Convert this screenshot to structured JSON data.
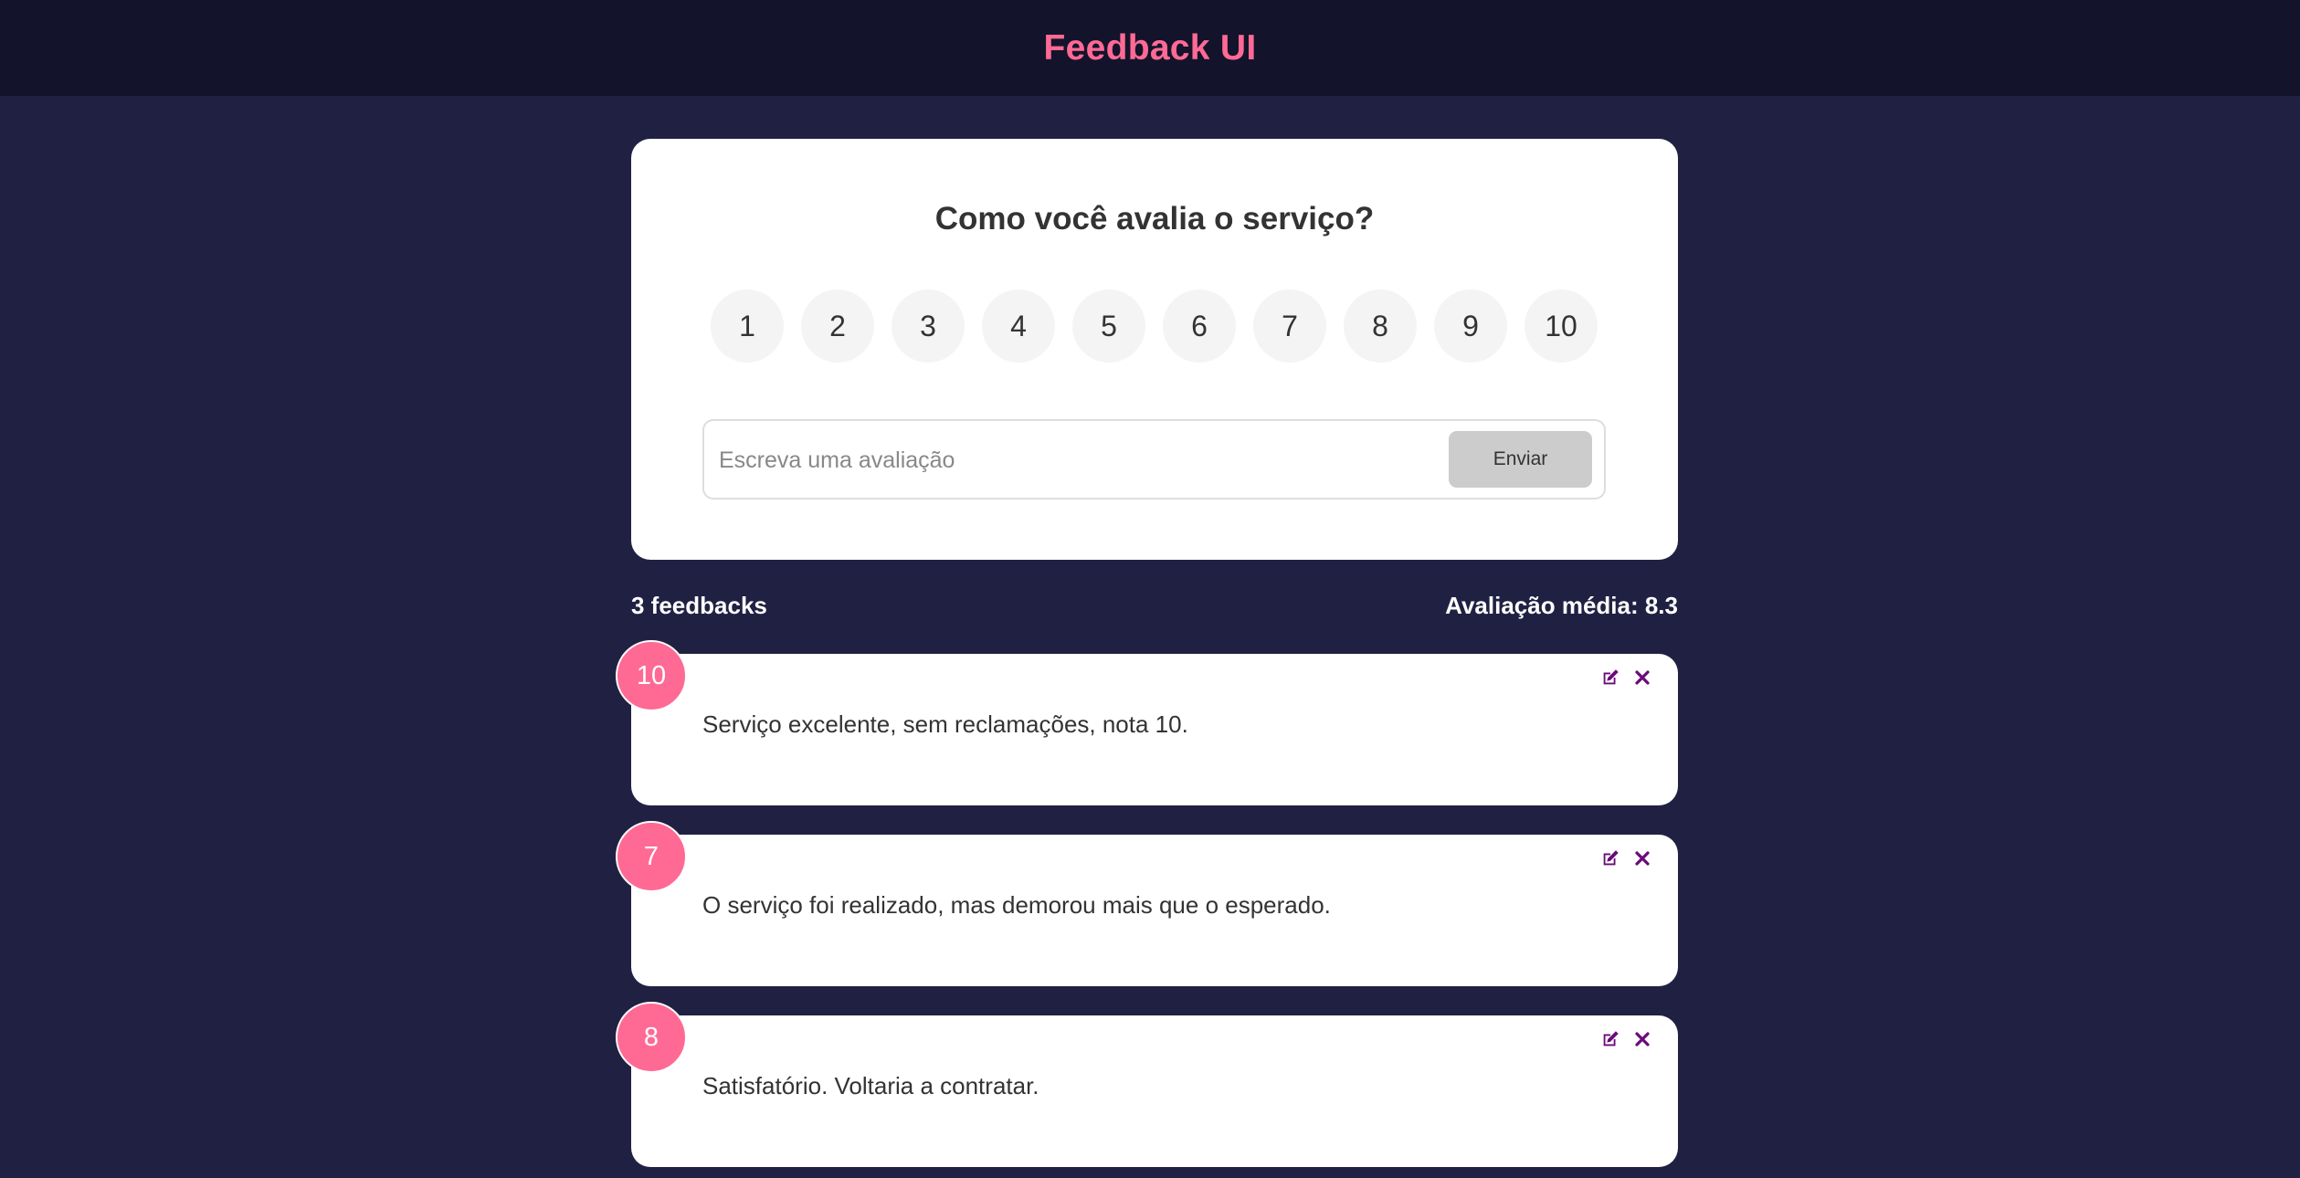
{
  "header": {
    "title": "Feedback UI"
  },
  "rating_card": {
    "question": "Como você avalia o serviço?",
    "options": [
      "1",
      "2",
      "3",
      "4",
      "5",
      "6",
      "7",
      "8",
      "9",
      "10"
    ],
    "input_placeholder": "Escreva uma avaliação",
    "send_label": "Enviar"
  },
  "stats": {
    "count_label": "3 feedbacks",
    "average_label": "Avaliação média: 8.3"
  },
  "feedbacks": [
    {
      "rating": "10",
      "text": "Serviço excelente, sem reclamações, nota 10."
    },
    {
      "rating": "7",
      "text": "O serviço foi realizado, mas demorou mais que o esperado."
    },
    {
      "rating": "8",
      "text": "Satisfatório. Voltaria a contratar."
    }
  ],
  "colors": {
    "background": "#202142",
    "header_background": "#13142b",
    "accent_pink": "#ff6a95",
    "icon_purple": "#6b0a7a"
  },
  "icons": {
    "edit": "edit-icon",
    "delete": "close-icon"
  }
}
